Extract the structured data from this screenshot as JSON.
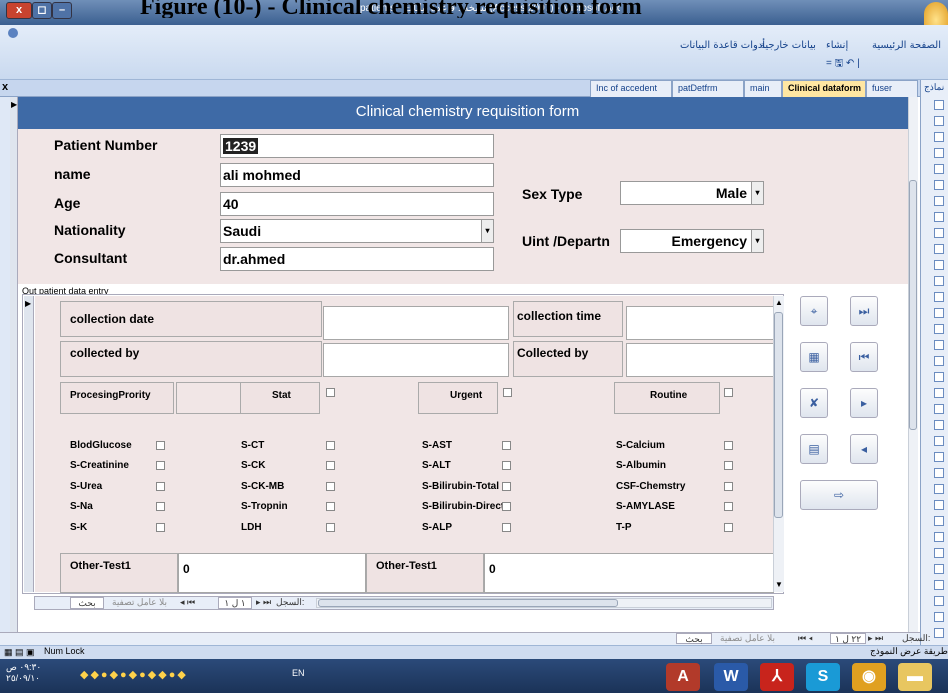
{
  "page_caption": "Figure (10-) - Clinical chemistry requisition form",
  "window": {
    "title": "patients - نسخة : قاعدة بيانات (Access 2007) - Microsoft Access",
    "buttons": [
      "x",
      "◻",
      "–"
    ]
  },
  "ribbon": {
    "tabs": [
      "الصفحة الرئيسية",
      "إنشاء",
      "بيانات خارجية",
      "أدوات قاعدة البيانات"
    ],
    "qat": "= 🖫 ↶ |"
  },
  "object_tabs": [
    {
      "label": "Inc of accedent",
      "active": false
    },
    {
      "label": "patDetfrm",
      "active": false
    },
    {
      "label": "main",
      "active": false
    },
    {
      "label": "Clinical dataform",
      "active": true
    },
    {
      "label": "fuser",
      "active": false
    }
  ],
  "right_pane": {
    "label": "نماذج"
  },
  "form": {
    "header": "Clinical chemistry requisition form",
    "labels": {
      "patient_number": "Patient Number",
      "name": "name",
      "age": "Age",
      "nationality": "Nationality",
      "consultant": "Consultant",
      "sex_type": "Sex Type",
      "unit": "Uint /Departn"
    },
    "values": {
      "patient_number": "1239",
      "name": "ali mohmed",
      "age": "40",
      "nationality": "Saudi",
      "consultant": "dr.ahmed",
      "sex_type": "Male",
      "unit": "Emergency"
    }
  },
  "subform": {
    "caption": "Out patient  data entry",
    "collection_date": "collection date",
    "collection_time": "collection time",
    "collected_by_1": "collected by",
    "collected_by_2": "Collected by",
    "processing_priority": "ProcesingPrority",
    "stat": "Stat",
    "urgent": "Urgent",
    "routine": "Routine",
    "tests_col1": [
      "BlodGlucose",
      "S-Creatinine",
      "S-Urea",
      "S-Na",
      "S-K"
    ],
    "tests_col2": [
      "S-CT",
      "S-CK",
      "S-CK-MB",
      "S-Tropnin",
      "LDH"
    ],
    "tests_col3": [
      "S-AST",
      "S-ALT",
      "S-Bilirubin-Total",
      "S-Bilirubin-Direct",
      "S-ALP"
    ],
    "tests_col4": [
      "S-Calcium",
      "S-Albumin",
      "CSF-Chemstry",
      "S-AMYLASE",
      "T-P"
    ],
    "other_test_1_label": "Other-Test1",
    "other_test_1_value": "0",
    "other_test_2_label": "Other-Test1",
    "other_test_2_value": "0"
  },
  "sub_nav": {
    "search": "بحث",
    "filter": "بلا عامل تصفية",
    "record": "السجل:",
    "counter": "١ ل ١"
  },
  "main_nav": {
    "search": "بحث",
    "filter": "بلا عامل تصفية",
    "record": "السجل:",
    "counter": "٢٢ ل ١"
  },
  "status": {
    "num_lock": "Num Lock",
    "view": "طريقة عرض النموذج"
  },
  "taskbar": {
    "clock_time": "٠٩:٣٠ ص",
    "clock_date": "٢٥/٠٩/١٠",
    "lang": "EN"
  },
  "colors": {
    "header": "#3e6aa6",
    "form_bg": "#f1e6e6",
    "active_tab": "#ffe7a2"
  },
  "icons": {
    "find": "binoculars-icon",
    "next_record": "next-record-icon",
    "save": "save-record-icon",
    "prev_record": "previous-record-icon",
    "delete": "delete-record-icon",
    "go_next": "go-next-icon",
    "new": "new-record-icon",
    "go_prev": "go-previous-icon",
    "exit": "exit-form-icon"
  }
}
